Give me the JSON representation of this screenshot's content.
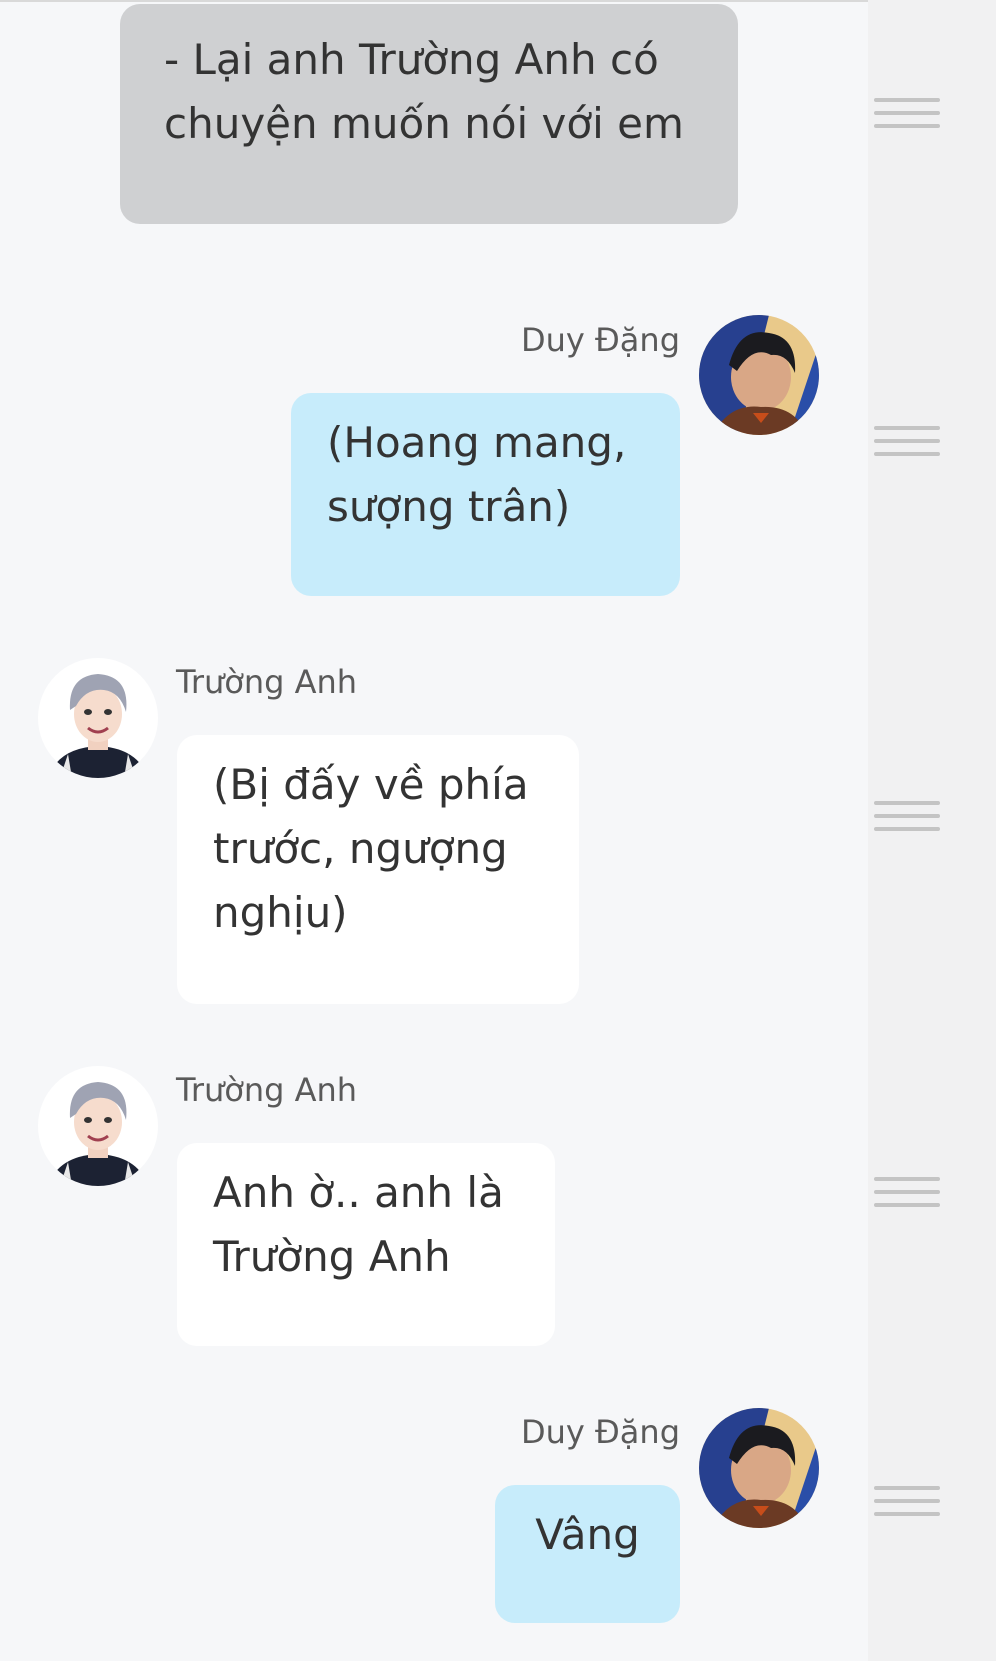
{
  "messages": {
    "m1": {
      "type": "narration",
      "text": "- Lại anh Trường Anh có\nchuyện muốn nói với em"
    },
    "m2": {
      "type": "self",
      "sender": "Duy Đặng",
      "text": "(Hoang mang,\nsượng trân)"
    },
    "m3": {
      "type": "other",
      "sender": "Trường Anh",
      "text": "(Bị đấy về phía\ntrước, ngượng\nnghịu)"
    },
    "m4": {
      "type": "other",
      "sender": "Trường Anh",
      "text": "Anh ờ.. anh là\nTrường Anh"
    },
    "m5": {
      "type": "self",
      "sender": "Duy Đặng",
      "text": "Vâng"
    }
  },
  "icons": {
    "handle": "drag-handle-icon",
    "avatar_self": "avatar-duy-dang",
    "avatar_other": "avatar-truong-anh"
  },
  "colors": {
    "narration_bubble": "#cfd0d2",
    "self_bubble": "#c7ecfb",
    "other_bubble": "#ffffff",
    "background": "#f6f7f9",
    "rail": "#f1f1f2"
  }
}
